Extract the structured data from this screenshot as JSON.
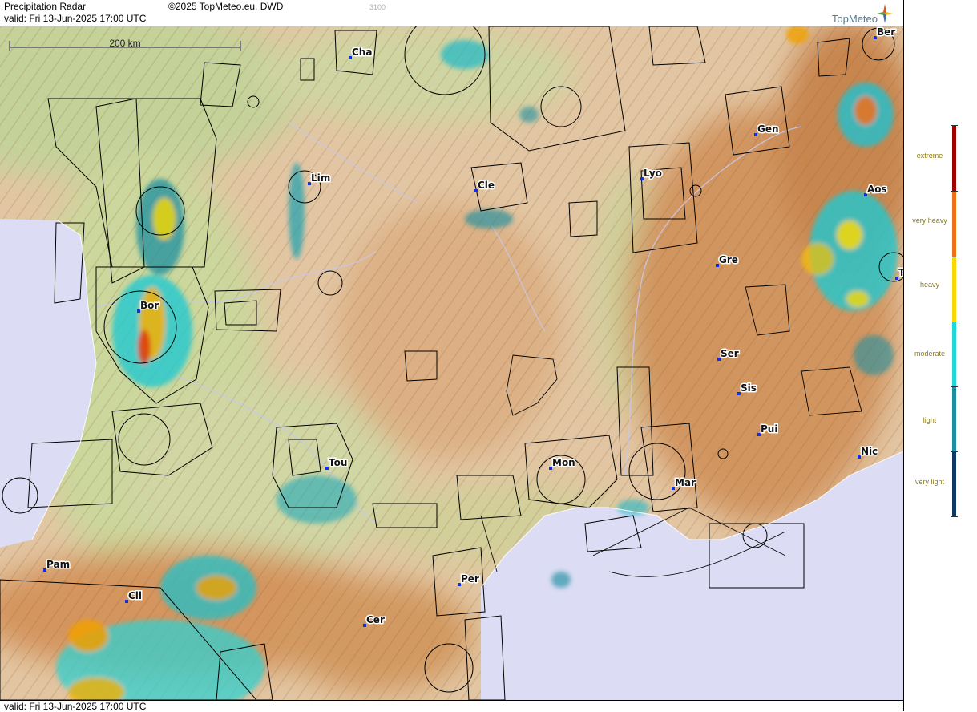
{
  "header": {
    "title": "Precipitation Radar",
    "copyright": "©2025 TopMeteo.eu, DWD",
    "code": "3100",
    "valid": "valid:  Fri  13-Jun-2025 17:00 UTC",
    "logo": "TopMeteo"
  },
  "footer": {
    "valid": "valid:  Fri  13-Jun-2025 17:00 UTC"
  },
  "scale_bar": {
    "label": "200 km"
  },
  "legend": {
    "items": [
      {
        "label": "extreme",
        "color": "#a00000"
      },
      {
        "label": "very heavy",
        "color": "#f07018"
      },
      {
        "label": "heavy",
        "color": "#f8d800"
      },
      {
        "label": "moderate",
        "color": "#20d8d8"
      },
      {
        "label": "light",
        "color": "#1a8fa0"
      },
      {
        "label": "very light",
        "color": "#103860"
      }
    ]
  },
  "cities": [
    {
      "name": "Cha"
    },
    {
      "name": "Ber"
    },
    {
      "name": "Gen"
    },
    {
      "name": "Lim"
    },
    {
      "name": "Cle"
    },
    {
      "name": "Lyo"
    },
    {
      "name": "Aos"
    },
    {
      "name": "Gre"
    },
    {
      "name": "Bor"
    },
    {
      "name": "Ser"
    },
    {
      "name": "Sis"
    },
    {
      "name": "Pui"
    },
    {
      "name": "Tou"
    },
    {
      "name": "Mon"
    },
    {
      "name": "Mar"
    },
    {
      "name": "Nic"
    },
    {
      "name": "Pam"
    },
    {
      "name": "Cil"
    },
    {
      "name": "Per"
    },
    {
      "name": "Cer"
    },
    {
      "name": "T"
    }
  ],
  "colors": {
    "sea": "#dcdcf4",
    "lowland": "#c9d49a",
    "hills": "#e4c7a6",
    "mountains": "#d49a62",
    "airspace": "#000000"
  }
}
